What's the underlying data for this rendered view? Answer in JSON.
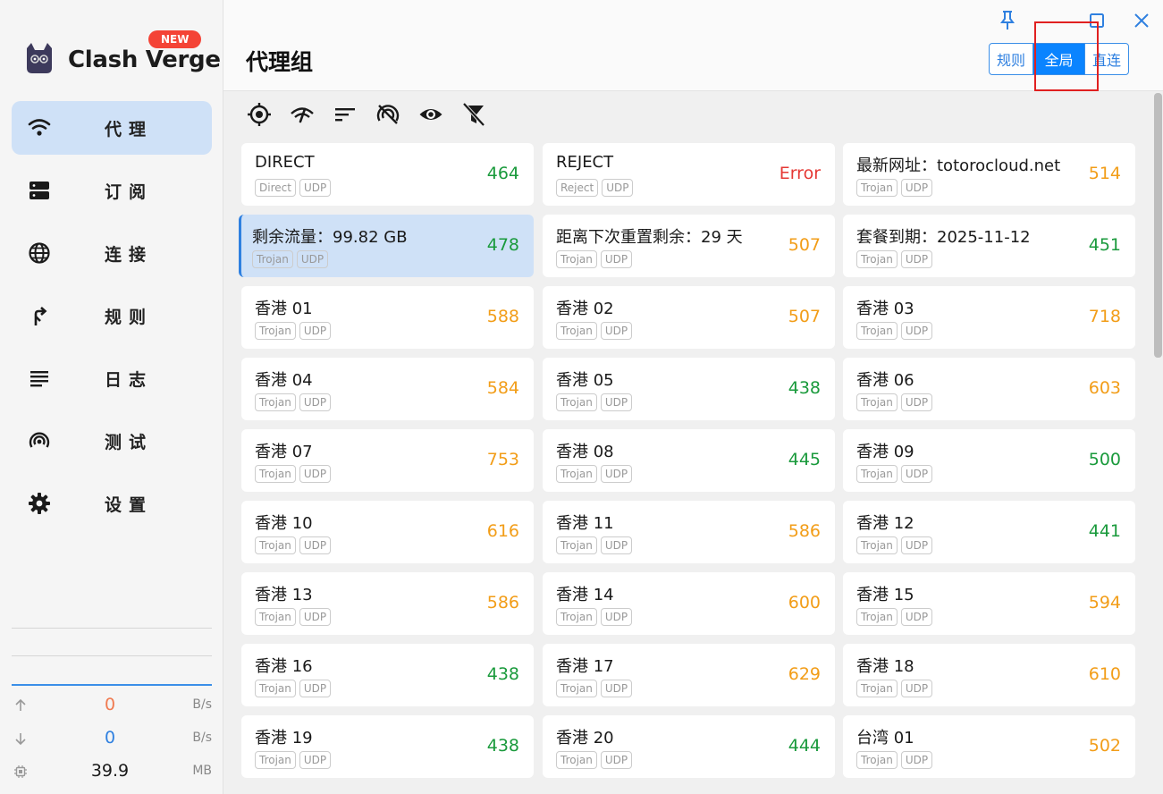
{
  "app": {
    "name": "Clash Verge",
    "badge": "NEW"
  },
  "sidebar": {
    "items": [
      {
        "label": "代理",
        "icon": "wifi-icon",
        "active": true
      },
      {
        "label": "订阅",
        "icon": "server-icon",
        "active": false
      },
      {
        "label": "连接",
        "icon": "globe-icon",
        "active": false
      },
      {
        "label": "规则",
        "icon": "fork-arrow-icon",
        "active": false
      },
      {
        "label": "日志",
        "icon": "list-lines-icon",
        "active": false
      },
      {
        "label": "测试",
        "icon": "broadcast-icon",
        "active": false
      },
      {
        "label": "设置",
        "icon": "gear-icon",
        "active": false
      }
    ]
  },
  "traffic": {
    "upload": {
      "value": "0",
      "unit": "B/s",
      "color": "#f07a50"
    },
    "download": {
      "value": "0",
      "unit": "B/s",
      "color": "#2f80e0"
    },
    "memory": {
      "value": "39.9",
      "unit": "MB"
    }
  },
  "header": {
    "title": "代理组",
    "modes": [
      {
        "label": "规则",
        "active": false
      },
      {
        "label": "全局",
        "active": true
      },
      {
        "label": "直连",
        "active": false
      }
    ]
  },
  "toolbar": {
    "icons": [
      "locate-icon",
      "speed-test-icon",
      "sort-icon",
      "no-signal-icon",
      "eye-icon",
      "filter-off-icon"
    ]
  },
  "proxies": [
    {
      "name": "DIRECT",
      "tags": [
        "Direct",
        "UDP"
      ],
      "delay": "464",
      "level": "green"
    },
    {
      "name": "REJECT",
      "tags": [
        "Reject",
        "UDP"
      ],
      "delay": "Error",
      "level": "red"
    },
    {
      "name": "最新网址：totorocloud.net",
      "tags": [
        "Trojan",
        "UDP"
      ],
      "delay": "514",
      "level": "orange"
    },
    {
      "name": "剩余流量：99.82 GB",
      "tags": [
        "Trojan",
        "UDP"
      ],
      "delay": "478",
      "level": "green",
      "selected": true
    },
    {
      "name": "距离下次重置剩余：29 天",
      "tags": [
        "Trojan",
        "UDP"
      ],
      "delay": "507",
      "level": "orange"
    },
    {
      "name": "套餐到期：2025-11-12",
      "tags": [
        "Trojan",
        "UDP"
      ],
      "delay": "451",
      "level": "green"
    },
    {
      "name": "香港 01",
      "tags": [
        "Trojan",
        "UDP"
      ],
      "delay": "588",
      "level": "orange"
    },
    {
      "name": "香港 02",
      "tags": [
        "Trojan",
        "UDP"
      ],
      "delay": "507",
      "level": "orange"
    },
    {
      "name": "香港 03",
      "tags": [
        "Trojan",
        "UDP"
      ],
      "delay": "718",
      "level": "orange"
    },
    {
      "name": "香港 04",
      "tags": [
        "Trojan",
        "UDP"
      ],
      "delay": "584",
      "level": "orange"
    },
    {
      "name": "香港 05",
      "tags": [
        "Trojan",
        "UDP"
      ],
      "delay": "438",
      "level": "green"
    },
    {
      "name": "香港 06",
      "tags": [
        "Trojan",
        "UDP"
      ],
      "delay": "603",
      "level": "orange"
    },
    {
      "name": "香港 07",
      "tags": [
        "Trojan",
        "UDP"
      ],
      "delay": "753",
      "level": "orange"
    },
    {
      "name": "香港 08",
      "tags": [
        "Trojan",
        "UDP"
      ],
      "delay": "445",
      "level": "green"
    },
    {
      "name": "香港 09",
      "tags": [
        "Trojan",
        "UDP"
      ],
      "delay": "500",
      "level": "green"
    },
    {
      "name": "香港 10",
      "tags": [
        "Trojan",
        "UDP"
      ],
      "delay": "616",
      "level": "orange"
    },
    {
      "name": "香港 11",
      "tags": [
        "Trojan",
        "UDP"
      ],
      "delay": "586",
      "level": "orange"
    },
    {
      "name": "香港 12",
      "tags": [
        "Trojan",
        "UDP"
      ],
      "delay": "441",
      "level": "green"
    },
    {
      "name": "香港 13",
      "tags": [
        "Trojan",
        "UDP"
      ],
      "delay": "586",
      "level": "orange"
    },
    {
      "name": "香港 14",
      "tags": [
        "Trojan",
        "UDP"
      ],
      "delay": "600",
      "level": "orange"
    },
    {
      "name": "香港 15",
      "tags": [
        "Trojan",
        "UDP"
      ],
      "delay": "594",
      "level": "orange"
    },
    {
      "name": "香港 16",
      "tags": [
        "Trojan",
        "UDP"
      ],
      "delay": "438",
      "level": "green"
    },
    {
      "name": "香港 17",
      "tags": [
        "Trojan",
        "UDP"
      ],
      "delay": "629",
      "level": "orange"
    },
    {
      "name": "香港 18",
      "tags": [
        "Trojan",
        "UDP"
      ],
      "delay": "610",
      "level": "orange"
    },
    {
      "name": "香港 19",
      "tags": [
        "Trojan",
        "UDP"
      ],
      "delay": "438",
      "level": "green"
    },
    {
      "name": "香港 20",
      "tags": [
        "Trojan",
        "UDP"
      ],
      "delay": "444",
      "level": "green"
    },
    {
      "name": "台湾 01",
      "tags": [
        "Trojan",
        "UDP"
      ],
      "delay": "502",
      "level": "orange"
    }
  ]
}
